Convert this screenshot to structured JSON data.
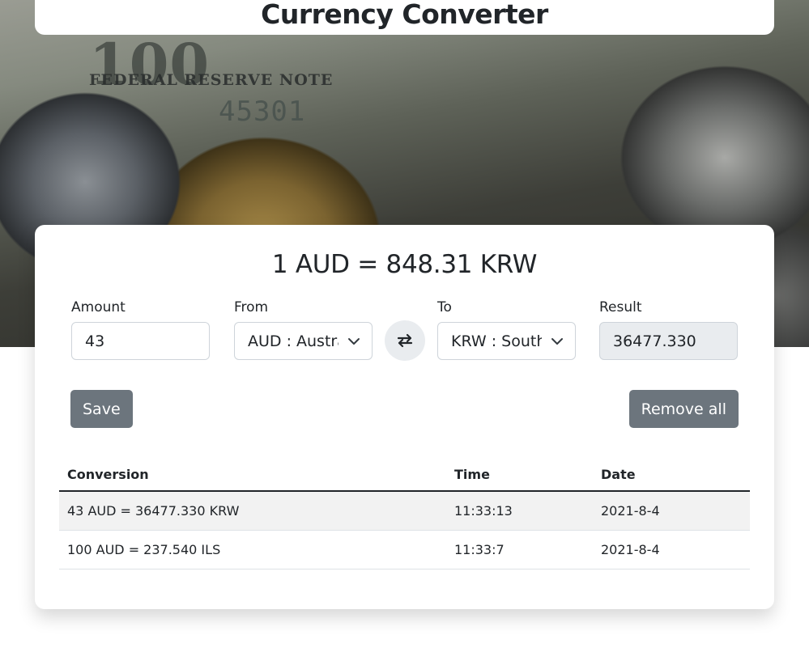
{
  "app": {
    "title": "Currency Converter"
  },
  "rate_line": "1 AUD = 848.31 KRW",
  "form": {
    "amount": {
      "label": "Amount",
      "value": "43"
    },
    "from": {
      "label": "From",
      "value": "AUD : Australian Dollar"
    },
    "to": {
      "label": "To",
      "value": "KRW : South Korean Won"
    },
    "result": {
      "label": "Result",
      "value": "36477.330"
    },
    "swap_icon": "swap-arrows-icon"
  },
  "actions": {
    "save_label": "Save",
    "remove_all_label": "Remove all"
  },
  "history": {
    "columns": [
      "Conversion",
      "Time",
      "Date"
    ],
    "rows": [
      {
        "conversion": "43 AUD = 36477.330 KRW",
        "time": "11:33:13",
        "date": "2021-8-4"
      },
      {
        "conversion": "100 AUD = 237.540 ILS",
        "time": "11:33:7",
        "date": "2021-8-4"
      }
    ]
  },
  "colors": {
    "button_bg": "#6c757d",
    "readonly_bg": "#e9ecef",
    "border": "#ced4da"
  }
}
